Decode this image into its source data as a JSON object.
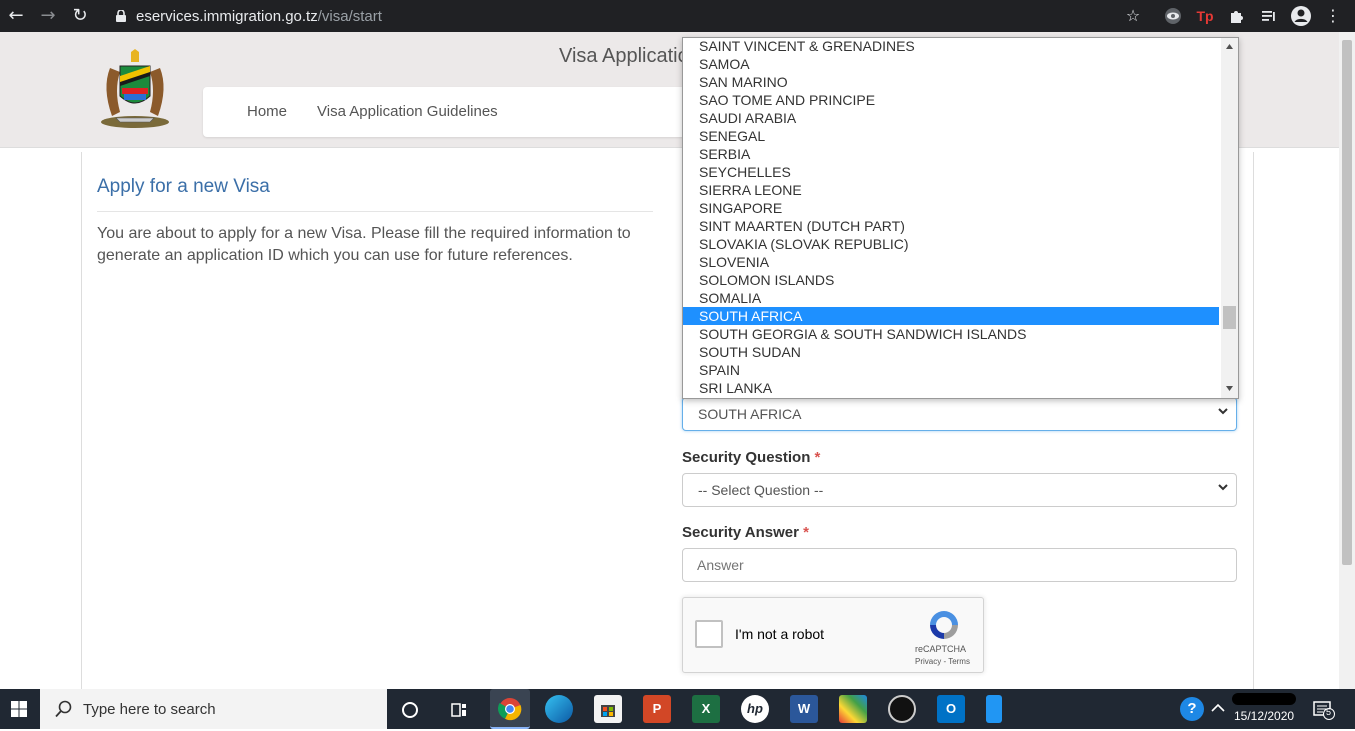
{
  "browser": {
    "url_domain": "eservices.immigration.go.tz",
    "url_path": "/visa/start",
    "icons": [
      "back-arrow-icon",
      "forward-arrow-icon",
      "reload-icon",
      "lock-icon",
      "star-icon",
      "eye-extension-icon",
      "tp-extension-icon",
      "puzzle-icon",
      "media-icon",
      "profile-icon",
      "more-icon"
    ],
    "tp_label": "Tp"
  },
  "header": {
    "site_title": "Visa Applicatio",
    "nav": [
      "Home",
      "Visa Application Guidelines"
    ]
  },
  "main": {
    "title": "Apply for a new Visa",
    "intro": "You are about to apply for a new Visa. Please fill the required information to generate an application ID which you can use for future references."
  },
  "form": {
    "country_value": "SOUTH AFRICA",
    "security_question_label": "Security Question",
    "security_question_value": "-- Select Question --",
    "security_answer_label": "Security Answer",
    "security_answer_placeholder": "Answer",
    "required_mark": "*"
  },
  "captcha": {
    "label": "I'm not a robot",
    "brand": "reCAPTCHA",
    "terms": "Privacy - Terms"
  },
  "dropdown": {
    "options": [
      "SAINT VINCENT & GRENADINES",
      "SAMOA",
      "SAN MARINO",
      "SAO TOME AND PRINCIPE",
      "SAUDI ARABIA",
      "SENEGAL",
      "SERBIA",
      "SEYCHELLES",
      "SIERRA LEONE",
      "SINGAPORE",
      "SINT MAARTEN (DUTCH PART)",
      "SLOVAKIA (SLOVAK REPUBLIC)",
      "SLOVENIA",
      "SOLOMON ISLANDS",
      "SOMALIA",
      "SOUTH AFRICA",
      "SOUTH GEORGIA & SOUTH SANDWICH ISLANDS",
      "SOUTH SUDAN",
      "SPAIN",
      "SRI LANKA"
    ],
    "selected_index": 15
  },
  "taskbar": {
    "search_text": "Type here to search",
    "date": "15/12/2020",
    "notification_count": "5",
    "apps": [
      "cortana-icon",
      "task-view-icon",
      "chrome-icon",
      "edge-icon",
      "store-icon",
      "powerpoint-icon",
      "excel-icon",
      "hp-icon",
      "word-icon",
      "photos-icon",
      "camera-icon",
      "outlook-icon",
      "phone-icon"
    ]
  },
  "colors": {
    "chrome_bar": "#202124",
    "header_bg": "#ece9e9",
    "title_blue": "#3b6fa8",
    "selected_option": "#1e90ff",
    "required": "#d9534f",
    "taskbar": "#202833"
  }
}
